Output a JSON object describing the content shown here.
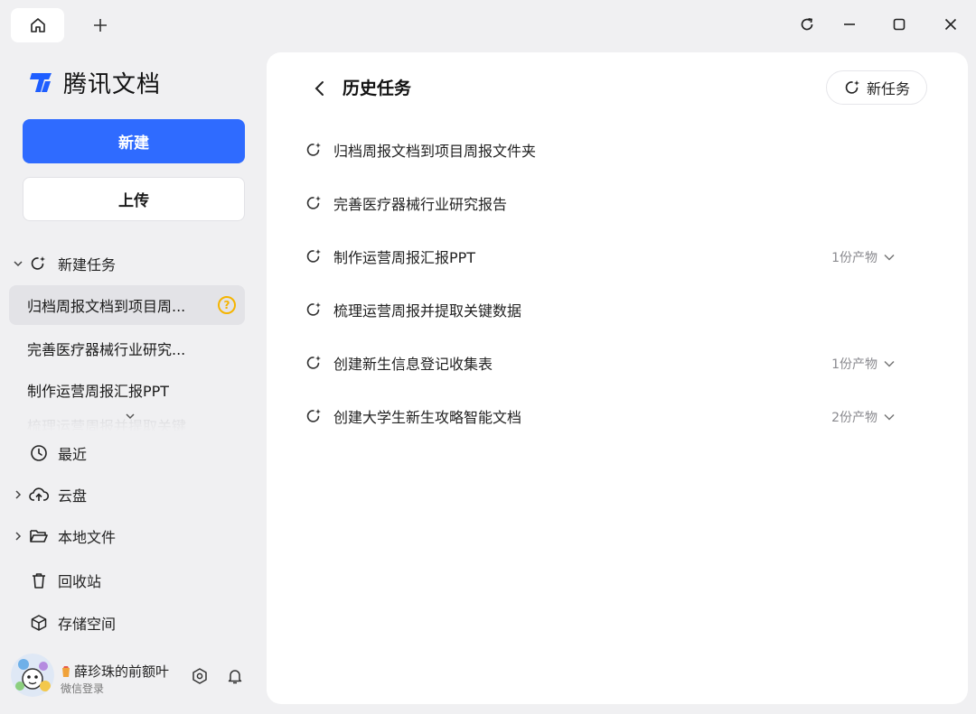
{
  "titlebar": {
    "home_icon": "home-icon",
    "new_tab_icon": "plus-icon",
    "controls": [
      "refresh-icon",
      "minimize-icon",
      "maximize-icon",
      "close-icon"
    ]
  },
  "sidebar": {
    "brand_name": "腾讯文档",
    "new_label": "新建",
    "upload_label": "上传",
    "tasks_section_label": "新建任务",
    "tasks": [
      {
        "label": "归档周报文档到项目周...",
        "active": true,
        "badge": "?"
      },
      {
        "label": "完善医疗器械行业研究...",
        "active": false
      },
      {
        "label": "制作运营周报汇报PPT",
        "active": false
      }
    ],
    "tasks_more_partial": "梳理运营周报并提取关键",
    "nav": [
      {
        "label": "最近",
        "icon": "clock-icon",
        "expandable": false
      },
      {
        "label": "云盘",
        "icon": "cloud-upload-icon",
        "expandable": true
      },
      {
        "label": "本地文件",
        "icon": "folder-icon",
        "expandable": true
      },
      {
        "label": "回收站",
        "icon": "trash-icon",
        "expandable": false
      },
      {
        "label": "存储空间",
        "icon": "box-icon",
        "expandable": false
      }
    ],
    "profile": {
      "name": "薛珍珠的前额叶",
      "sub": "微信登录"
    }
  },
  "main": {
    "title": "历史任务",
    "new_task_label": "新任务",
    "history": [
      {
        "label": "归档周报文档到项目周报文件夹",
        "outputs": ""
      },
      {
        "label": "完善医疗器械行业研究报告",
        "outputs": ""
      },
      {
        "label": "制作运营周报汇报PPT",
        "outputs": "1份产物"
      },
      {
        "label": "梳理运营周报并提取关键数据",
        "outputs": ""
      },
      {
        "label": "创建新生信息登记收集表",
        "outputs": "1份产物"
      },
      {
        "label": "创建大学生新生攻略智能文档",
        "outputs": "2份产物"
      }
    ]
  },
  "colors": {
    "accent": "#2f6bff",
    "badge": "#f5b400",
    "background": "#f0f0f2",
    "panel": "#ffffff"
  }
}
